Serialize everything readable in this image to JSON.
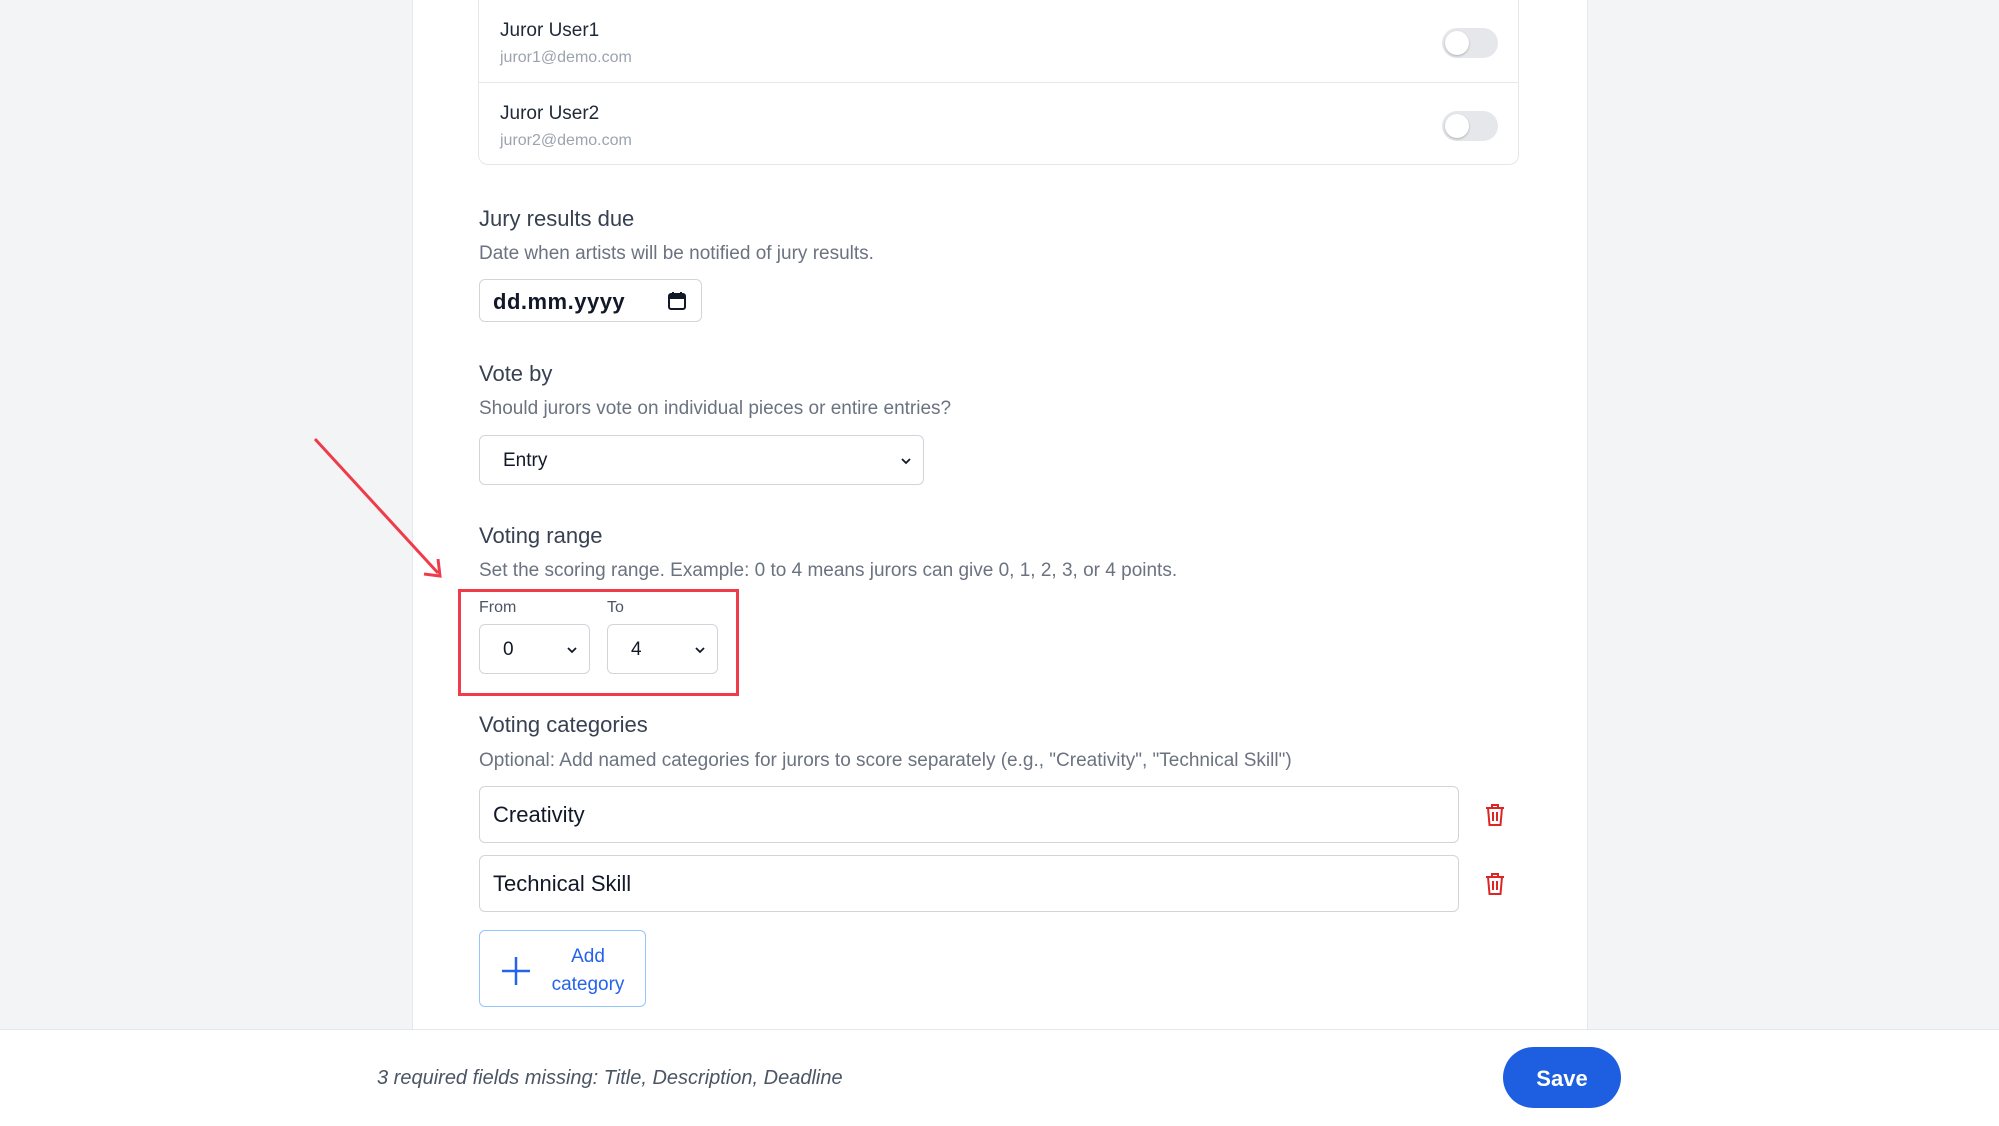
{
  "jurors": [
    {
      "name": "Juror User1",
      "email": "juror1@demo.com",
      "enabled": false
    },
    {
      "name": "Juror User2",
      "email": "juror2@demo.com",
      "enabled": false
    }
  ],
  "jury_results_due": {
    "label": "Jury results due",
    "help": "Date when artists will be notified of jury results.",
    "placeholder": "dd.mm.yyyy"
  },
  "vote_by": {
    "label": "Vote by",
    "help": "Should jurors vote on individual pieces or entire entries?",
    "selected": "Entry"
  },
  "voting_range": {
    "label": "Voting range",
    "help": "Set the scoring range. Example: 0 to 4 means jurors can give 0, 1, 2, 3, or 4 points.",
    "from_label": "From",
    "from_value": "0",
    "to_label": "To",
    "to_value": "4"
  },
  "voting_categories": {
    "label": "Voting categories",
    "help": "Optional: Add named categories for jurors to score separately (e.g., \"Creativity\", \"Technical Skill\")",
    "items": [
      "Creativity",
      "Technical Skill"
    ],
    "add_label_line1": "Add",
    "add_label_line2": "category"
  },
  "footer": {
    "missing_text": "3 required fields missing: Title, Description, Deadline",
    "save_label": "Save"
  },
  "colors": {
    "primary": "#1d5fe0",
    "annotation": "#ef3b4a",
    "delete": "#dc2626"
  }
}
